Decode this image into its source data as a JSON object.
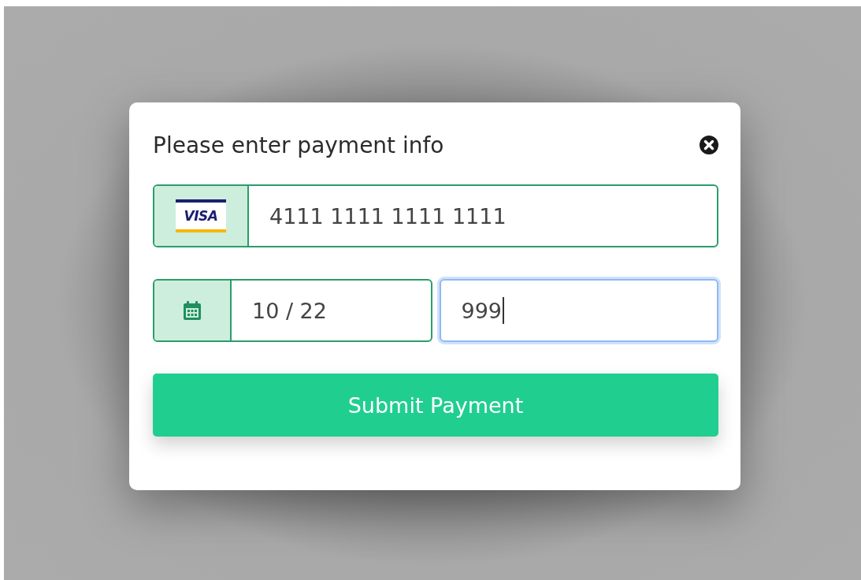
{
  "dialog": {
    "title": "Please enter payment info"
  },
  "card_field": {
    "logo_text": "VISA",
    "value": "4111 1111 1111 1111",
    "valid": true,
    "focused": false
  },
  "expiry_field": {
    "value": "10 / 22",
    "valid": true,
    "focused": false
  },
  "cvc_field": {
    "value": "999",
    "focused": true
  },
  "submit_button": {
    "label": "Submit Payment"
  }
}
